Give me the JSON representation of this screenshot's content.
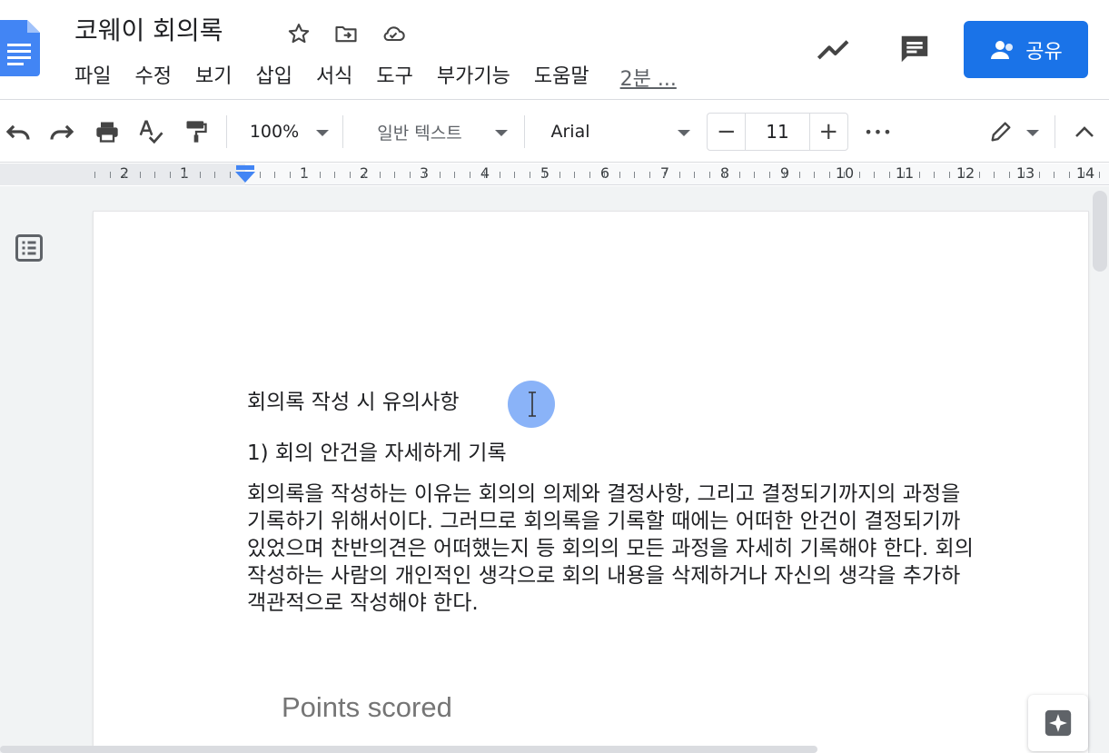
{
  "header": {
    "title": "코웨이 회의록",
    "menu": [
      "파일",
      "수정",
      "보기",
      "삽입",
      "서식",
      "도구",
      "부가기능",
      "도움말"
    ],
    "last_edit": "2분 ...",
    "share_label": "공유"
  },
  "toolbar": {
    "zoom": "100%",
    "style": "일반 텍스트",
    "font": "Arial",
    "font_size": "11",
    "minus": "−",
    "plus": "+",
    "more": "•••"
  },
  "ruler": {
    "labels": [
      "2",
      "1",
      "1",
      "2",
      "3",
      "4",
      "5",
      "6",
      "7",
      "8",
      "9",
      "10",
      "11",
      "12",
      "13",
      "14"
    ]
  },
  "document": {
    "heading": "회의록 작성 시 유의사항",
    "subheading": "1) 회의 안건을 자세하게 기록",
    "paragraph_lines": [
      "회의록을 작성하는 이유는 회의의 의제와 결정사항, 그리고 결정되기까지의 과정을",
      "기록하기 위해서이다. 그러므로 회의록을 기록할 때에는 어떠한 안건이 결정되기까",
      "있었으며 찬반의견은 어떠했는지 등 회의의 모든 과정을 자세히 기록해야 한다. 회의",
      "작성하는 사람의 개인적인 생각으로 회의 내용을 삭제하거나 자신의 생각을 추가하",
      "객관적으로 작성해야 한다."
    ],
    "chart_title": "Points scored"
  },
  "colors": {
    "accent": "#1a73e8",
    "docs_blue": "#4285f4",
    "canvas": "#f1f3f4"
  },
  "icons": [
    "docs-logo-icon",
    "star-icon",
    "move-folder-icon",
    "cloud-saved-icon",
    "activity-trend-icon",
    "comment-icon",
    "person-icon",
    "undo-icon",
    "redo-icon",
    "print-icon",
    "spellcheck-icon",
    "paint-format-icon",
    "pencil-edit-icon",
    "chevron-up-icon",
    "outline-icon",
    "explore-icon"
  ]
}
